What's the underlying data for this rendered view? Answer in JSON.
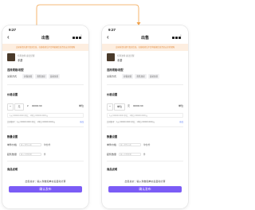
{
  "arrow_color": "#f2a24b",
  "accent_color": "#7b5cf6",
  "left": {
    "time": "9:27",
    "title": "出售",
    "notice": "交易前请先填写真实信息，在线收款后平台将依据信息资金安全的保障",
    "product_name": "哈利波特 魔法觉醒",
    "game": "手游",
    "section1": "选择规格/相型",
    "trade_label": "交易方式",
    "chips": [
      "担保交易",
      "寄售交易",
      "自助交易"
    ],
    "section2": "价格设置",
    "unit_select": "元",
    "yen": "¥",
    "amount": "00000.99",
    "unit_right": "单位",
    "hint": "1元=00000.0000 单位；1单位=00000.0000元",
    "sub": "比例参考：1元=00000.0000 单位；1单位=00000.0000元",
    "sub_link": "修改",
    "section3": "数量设置",
    "f1_label": "单件价格",
    "f1_placeholder": "输入单件价格",
    "f1_suffix": "单位/件",
    "f2_label": "起售数量",
    "f2_placeholder": "输入出售数量",
    "f2_suffix": "件",
    "section4": "商品说明",
    "total": "出售总价：输入件数和单价后自动计算",
    "button": "确认发布"
  },
  "right": {
    "time": "9:27",
    "title": "出售",
    "notice": "交易前请先填写真实信息，在线收款后平台将依据信息资金安全的保障",
    "product_name": "哈利波特 魔法觉醒",
    "game": "手游",
    "section1": "选择规格/相型",
    "trade_label": "交易方式",
    "chips": [
      "担保交易",
      "寄售交易",
      "自助交易"
    ],
    "section2": "价格设置",
    "unit_select": "单位",
    "yen": "元",
    "amount": "00000.99",
    "unit_right": "单位",
    "hint": "1元=00000.0000 单位；1单位=00000.0000元",
    "sub": "比例参考：1元=00000.0000 单位；1单位=00000.0000元",
    "sub_link": "修改",
    "section3": "数量设置",
    "f1_label": "单件价格",
    "f1_placeholder": "输入单件价格",
    "f1_suffix": "单位/件",
    "f2_label": "起售数量",
    "f2_placeholder": "输入出售数量",
    "f2_suffix": "件",
    "section4": "商品说明",
    "total": "出售总价：输入件数和单价后自动计算",
    "button": "确认发布"
  }
}
